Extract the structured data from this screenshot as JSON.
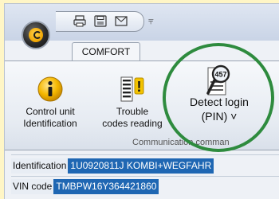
{
  "ribbon_tabs": [
    {
      "label": "COMFORT",
      "active": true
    }
  ],
  "quick_access": [
    {
      "icon": "print-icon"
    },
    {
      "icon": "disk-icon"
    },
    {
      "icon": "mail-icon"
    }
  ],
  "ribbon": {
    "buttons": [
      {
        "icon": "info-icon",
        "line1": "Control unit",
        "line2": "Identification"
      },
      {
        "icon": "trouble-codes-icon",
        "line1": "Trouble",
        "line2": "codes reading"
      },
      {
        "icon": "detect-login-icon",
        "line1": "Detect login",
        "line2": "(PIN) ˅"
      }
    ],
    "group_label": "Communication comman"
  },
  "fields": [
    {
      "label": "Identification",
      "value": "1U0920811J  KOMBI+WEGFAHR"
    },
    {
      "label": "VIN code",
      "value": "TMBPW16Y364421860"
    }
  ],
  "detect_badge": "457",
  "colors": {
    "highlight": "#2e8b3e",
    "selection": "#1f67b3",
    "orb": "#f0a400"
  }
}
